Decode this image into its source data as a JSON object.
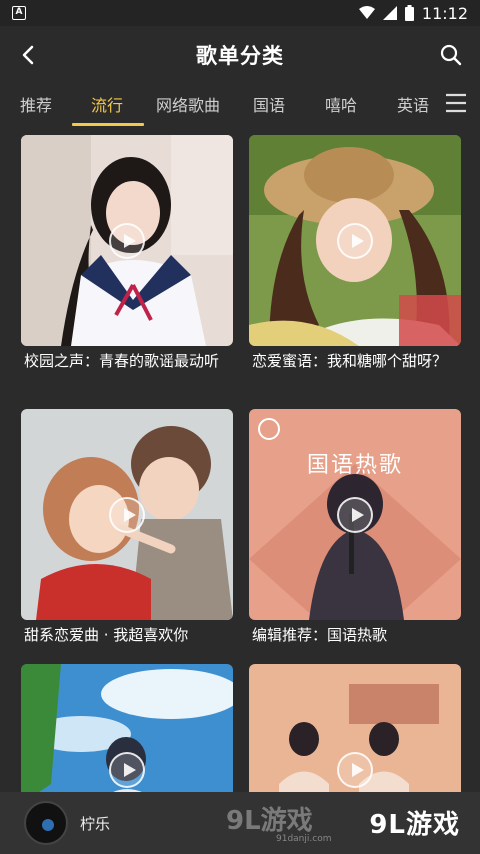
{
  "status_bar": {
    "app_icon_letter": "A",
    "time": "11:12"
  },
  "header": {
    "title": "歌单分类"
  },
  "tabs": [
    {
      "label": "推荐"
    },
    {
      "label": "流行"
    },
    {
      "label": "网络歌曲"
    },
    {
      "label": "国语"
    },
    {
      "label": "嘻哈"
    },
    {
      "label": "英语"
    }
  ],
  "active_tab": "流行",
  "playlists": [
    {
      "title": "校园之声：青春的歌谣最动听"
    },
    {
      "title": "恋爱蜜语：我和糖哪个甜呀？"
    },
    {
      "title": "甜系恋爱曲 · 我超喜欢你"
    },
    {
      "title": "编辑推荐：国语热歌",
      "cover_text": "国语热歌"
    },
    {
      "title": ""
    },
    {
      "title": ""
    }
  ],
  "player": {
    "song": "柠乐"
  },
  "watermark": {
    "text": "9L游戏",
    "url": "91danji.com"
  },
  "brand": {
    "text": "9L游戏"
  },
  "colors": {
    "accent": "#f2c94c",
    "background": "#2b2b2b"
  }
}
